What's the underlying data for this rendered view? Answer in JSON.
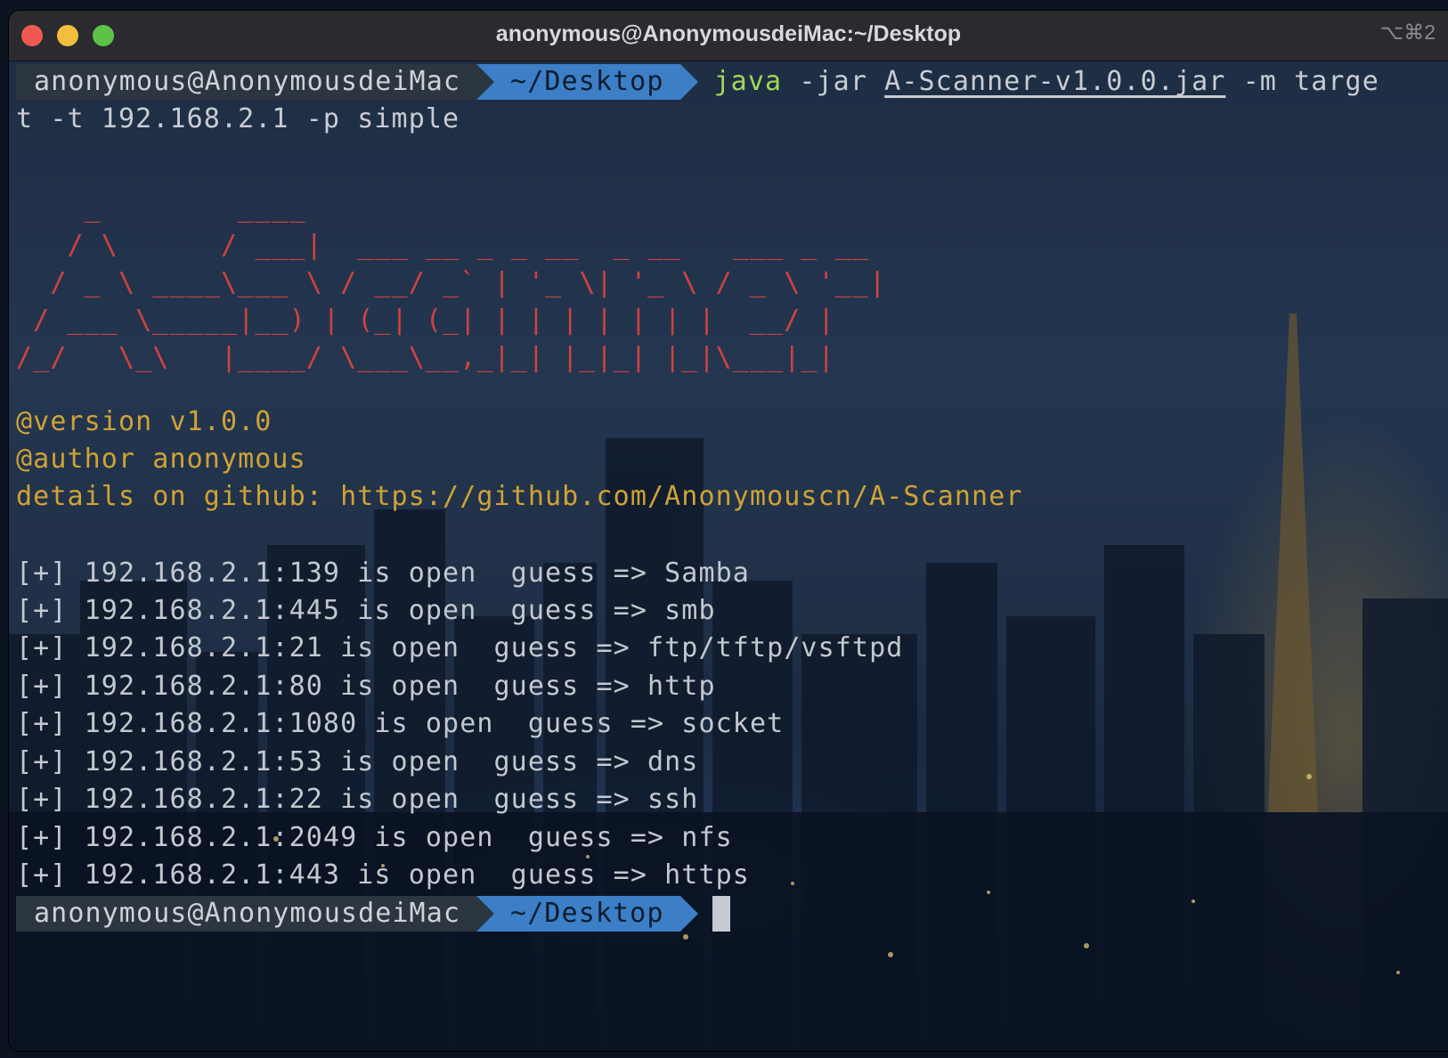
{
  "window": {
    "title": "anonymous@AnonymousdeiMac:~/Desktop",
    "shortcut": "⌥⌘2"
  },
  "prompt": {
    "user": "anonymous@AnonymousdeiMac",
    "dir": "~/Desktop"
  },
  "command": {
    "program": "java",
    "flag_jar": "-jar",
    "jar_file": "A-Scanner-v1.0.0.jar",
    "rest": "-m targe",
    "wrap": "t -t 192.168.2.1 -p simple"
  },
  "banner": [
    "    _        ____",
    "   / \\      / ___|  ___ __ _ _ __  _ __   ___ _ __",
    "  / _ \\ ____\\___ \\ / __/ _` | '_ \\| '_ \\ / _ \\ '__|",
    " / ___ \\_____|__) | (_| (_| | | | | | | |  __/ |",
    "/_/   \\_\\   |____/ \\___\\__,_|_| |_|_| |_|\\___|_|"
  ],
  "info": {
    "version": "@version v1.0.0",
    "author": "@author anonymous",
    "details": "details on github: https://github.com/Anonymouscn/A-Scanner"
  },
  "results": [
    "[+] 192.168.2.1:139 is open  guess => Samba",
    "[+] 192.168.2.1:445 is open  guess => smb",
    "[+] 192.168.2.1:21 is open  guess => ftp/tftp/vsftpd",
    "[+] 192.168.2.1:80 is open  guess => http",
    "[+] 192.168.2.1:1080 is open  guess => socket",
    "[+] 192.168.2.1:53 is open  guess => dns",
    "[+] 192.168.2.1:22 is open  guess => ssh",
    "[+] 192.168.2.1:2049 is open  guess => nfs",
    "[+] 192.168.2.1:443 is open  guess => https"
  ],
  "colors": {
    "banner": "#d0433f",
    "meta": "#cfa334",
    "command": "#9fd75a",
    "prompt_dir_bg": "#3c7fc7",
    "prompt_user_bg": "#2c3640"
  }
}
